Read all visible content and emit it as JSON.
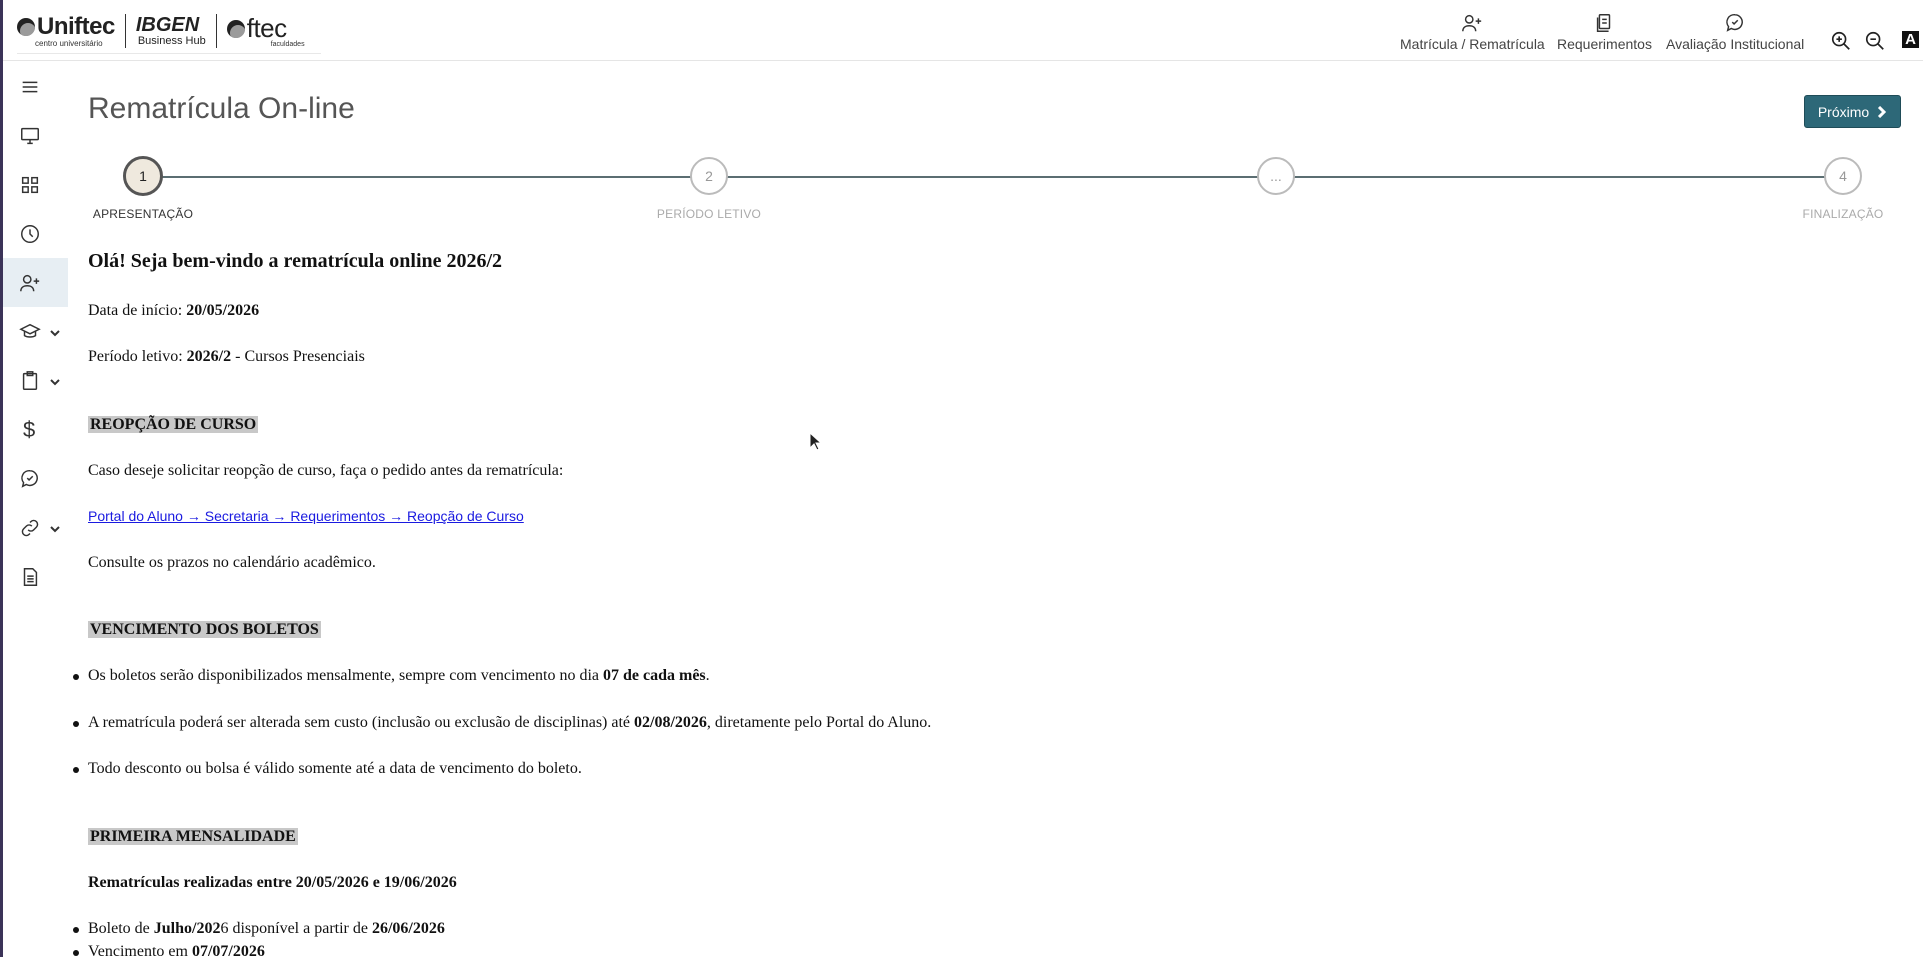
{
  "brand": {
    "uniftec": "Uniftec",
    "uniftec_sub": "centro universitário",
    "ibgen": "IBGEN",
    "ibgen_sub": "Business Hub",
    "ftec": "ftec",
    "ftec_sub": "faculdades"
  },
  "topnav": [
    {
      "label": "Matrícula / Rematrícula",
      "icon": "user-plus-icon"
    },
    {
      "label": "Requerimentos",
      "icon": "documents-icon"
    },
    {
      "label": "Avaliação Institucional",
      "icon": "chat-check-icon"
    }
  ],
  "tools": {
    "zoom_in": "zoom-in-icon",
    "zoom_out": "zoom-out-icon",
    "contrast": "A"
  },
  "sidebar": [
    {
      "icon": "menu-icon"
    },
    {
      "icon": "monitor-icon"
    },
    {
      "icon": "grid-icon"
    },
    {
      "icon": "clock-icon"
    },
    {
      "icon": "user-plus-icon",
      "active": true
    },
    {
      "icon": "graduation-cap-icon",
      "expandable": true
    },
    {
      "icon": "clipboard-icon",
      "expandable": true
    },
    {
      "icon": "dollar-icon",
      "glyph": "$"
    },
    {
      "icon": "chat-check-icon"
    },
    {
      "icon": "link-icon",
      "expandable": true
    },
    {
      "icon": "document-icon"
    }
  ],
  "page": {
    "title": "Rematrícula On-line",
    "next_label": "Próximo"
  },
  "steps": [
    {
      "number": "1",
      "label": "APRESENTAÇÃO",
      "active": true
    },
    {
      "number": "2",
      "label": "PERÍODO LETIVO",
      "active": false
    },
    {
      "number": "...",
      "label": "",
      "active": false
    },
    {
      "number": "4",
      "label": "FINALIZAÇÃO",
      "active": false
    }
  ],
  "content": {
    "welcome": "Olá! Seja bem-vindo a rematrícula online 2026/2",
    "start_label": "Data de início: ",
    "start_date": "20/05/2026",
    "period_label": "Período letivo: ",
    "period_value": "2026/2",
    "period_suffix": " - Cursos Presenciais",
    "reopcao_heading": "REOPÇÃO DE CURSO",
    "reopcao_text": "Caso deseje solicitar reopção de curso, faça o pedido antes da rematrícula:",
    "reopcao_link": "Portal do Aluno → Secretaria → Requerimentos → Reopção de Curso",
    "calendar_text": "Consulte os prazos no calendário acadêmico.",
    "boletos_heading": "VENCIMENTO DOS BOLETOS",
    "boletos_1a": "Os boletos serão disponibilizados mensalmente, sempre com vencimento no dia ",
    "boletos_1b": "07 de cada mês",
    "boletos_1c": ".",
    "boletos_2a": "A rematrícula poderá ser alterada sem custo (inclusão ou exclusão de disciplinas) até ",
    "boletos_2b": "02/08/2026",
    "boletos_2c": ", diretamente pelo Portal do Aluno.",
    "boletos_3": "Todo desconto ou bolsa é válido somente até a data de vencimento do boleto.",
    "primeira_heading": "PRIMEIRA MENSALIDADE",
    "primeira_sub": "Rematrículas realizadas entre 20/05/2026 e 19/06/2026",
    "primeira_1a": "Boleto de ",
    "primeira_1b": "Julho/202",
    "primeira_1c": "6 disponível a partir de ",
    "primeira_1d": "26/06/2026",
    "primeira_2a": "Vencimento em ",
    "primeira_2b": "07/07/2026"
  }
}
